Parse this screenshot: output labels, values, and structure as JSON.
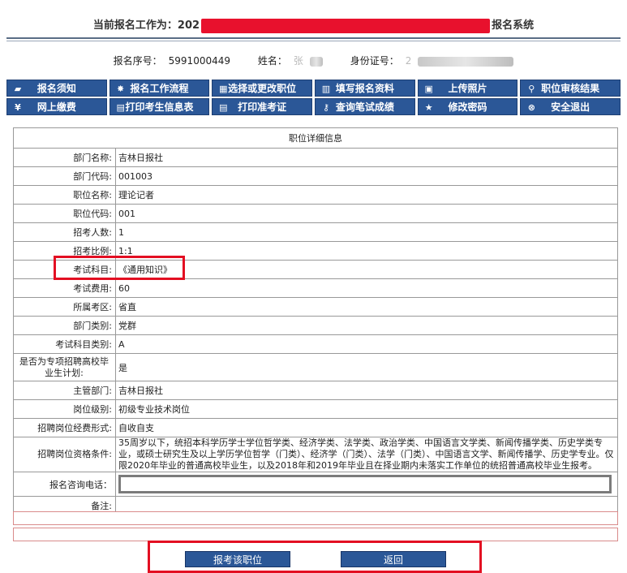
{
  "header": {
    "title_prefix": "当前报名工作为：202",
    "title_suffix": "报名系统"
  },
  "user": {
    "reg_label": "报名序号：",
    "reg_no": "5991000449",
    "name_label": "姓名：",
    "name_value": "张",
    "id_label": "身份证号：",
    "id_value": "2"
  },
  "nav": [
    {
      "label": "报名须知",
      "icon": "speech-bubble-icon",
      "glyph": "▰"
    },
    {
      "label": "报名工作流程",
      "icon": "sun-icon",
      "glyph": "✸"
    },
    {
      "label": "选择或更改职位",
      "icon": "windows-icon",
      "glyph": "▦"
    },
    {
      "label": "填写报名资料",
      "icon": "book-icon",
      "glyph": "▥"
    },
    {
      "label": "上传照片",
      "icon": "picture-icon",
      "glyph": "▣"
    },
    {
      "label": "职位审核结果",
      "icon": "magnifier-icon",
      "glyph": "⚲"
    },
    {
      "label": "网上缴费",
      "icon": "yen-icon",
      "glyph": "¥"
    },
    {
      "label": "打印考生信息表",
      "icon": "printer-icon",
      "glyph": "▤"
    },
    {
      "label": "打印准考证",
      "icon": "printer-icon",
      "glyph": "▤"
    },
    {
      "label": "查询笔试成绩",
      "icon": "key-icon",
      "glyph": "⚷"
    },
    {
      "label": "修改密码",
      "icon": "star-icon",
      "glyph": "★"
    },
    {
      "label": "安全退出",
      "icon": "exit-icon",
      "glyph": "⊗"
    }
  ],
  "detail": {
    "caption": "职位详细信息",
    "rows": [
      {
        "label": "部门名称:",
        "value": "吉林日报社"
      },
      {
        "label": "部门代码:",
        "value": "001003"
      },
      {
        "label": "职位名称:",
        "value": "理论记者"
      },
      {
        "label": "职位代码:",
        "value": "001"
      },
      {
        "label": "招考人数:",
        "value": "1"
      },
      {
        "label": "招考比例:",
        "value": "1:1"
      },
      {
        "label": "考试科目:",
        "value": "《通用知识》"
      },
      {
        "label": "考试费用:",
        "value": "60"
      },
      {
        "label": "所属考区:",
        "value": "省直"
      },
      {
        "label": "部门类别:",
        "value": "党群"
      },
      {
        "label": "考试科目类别:",
        "value": "A"
      },
      {
        "label": "是否为专项招聘高校毕业生计划:",
        "value": "是"
      },
      {
        "label": "主管部门:",
        "value": "吉林日报社"
      },
      {
        "label": "岗位级别:",
        "value": "初级专业技术岗位"
      },
      {
        "label": "招聘岗位经费形式:",
        "value": "自收自支"
      },
      {
        "label": "招聘岗位资格条件:",
        "value": "35周岁以下，统招本科学历学士学位哲学类、经济学类、法学类、政治学类、中国语言文学类、新闻传播学类、历史学类专业，或硕士研究生及以上学历学位哲学（门类）、经济学（门类）、法学（门类）、中国语言文学、新闻传播学、历史学专业。仅限2020年毕业的普通高校毕业生，以及2018年和2019年毕业且在择业期内未落实工作单位的统招普通高校毕业生报考。"
      },
      {
        "label": "报名咨询电话：",
        "value": ""
      },
      {
        "label": "备注:",
        "value": ""
      }
    ]
  },
  "actions": {
    "apply": "报考该职位",
    "back": "返回"
  },
  "colors": {
    "nav_bg": "#2b5797",
    "highlight": "#e30f22"
  }
}
